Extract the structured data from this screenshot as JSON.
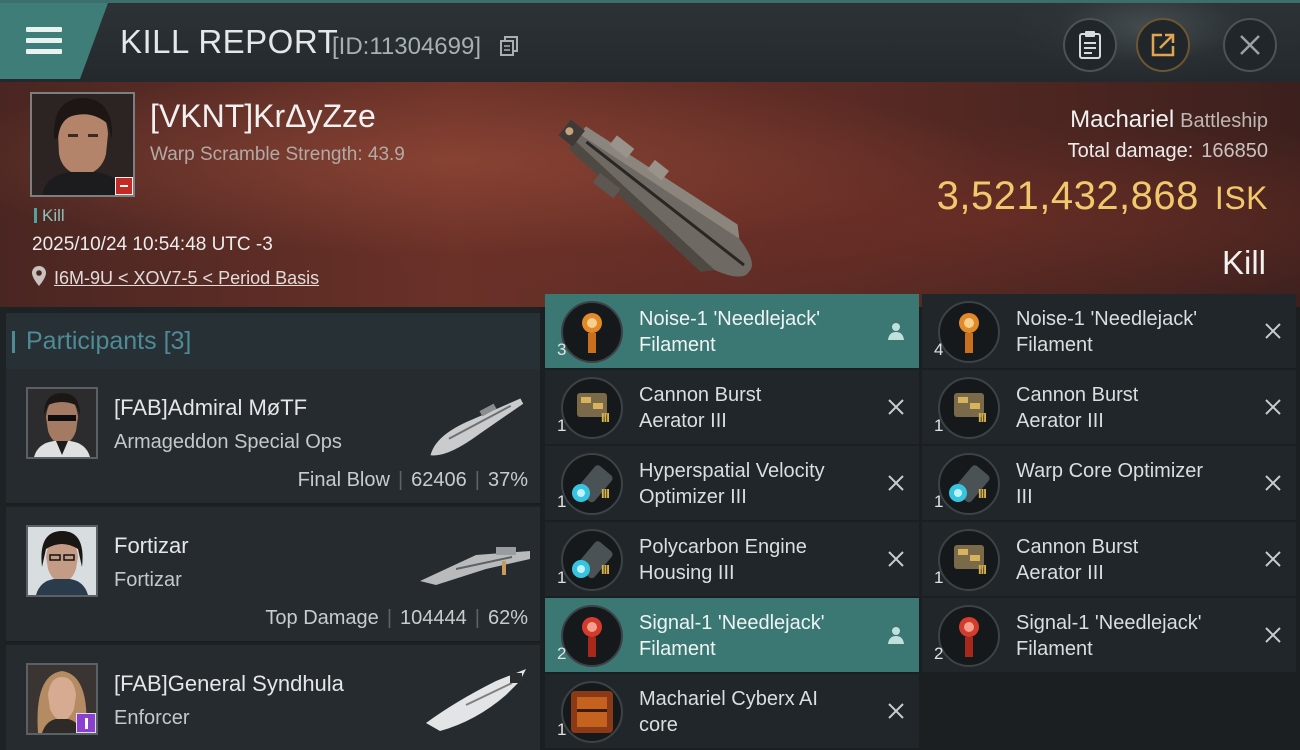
{
  "header": {
    "title": "KILL REPORT",
    "report_id": "[ID:11304699]",
    "menu_icon": "hamburger-icon",
    "copy_icon": "copy-icon",
    "buttons": [
      "clipboard-icon",
      "share-icon",
      "close-icon"
    ]
  },
  "victim": {
    "name": "[VKNT]KrΔyZze",
    "scramble": "Warp Scramble Strength: 43.9",
    "kill_tag": "Kill",
    "datetime": "2025/10/24 10:54:48 UTC -3",
    "location": "I6M-9U < XOV7-5 < Period Basis",
    "ship_name": "Machariel",
    "ship_class": "Battleship",
    "total_damage_label": "Total damage:",
    "total_damage": "166850",
    "isk_value": "3,521,432,868",
    "isk_unit": "ISK",
    "result": "Kill"
  },
  "participants": {
    "header_label": "Participants",
    "header_count": "[3]",
    "list": [
      {
        "name": "[FAB]Admiral MøTF",
        "ship": "Armageddon Special Ops",
        "stat_label": "Final Blow",
        "damage": "62406",
        "percent": "37%"
      },
      {
        "name": "Fortizar",
        "ship": "Fortizar",
        "stat_label": "Top Damage",
        "damage": "104444",
        "percent": "62%"
      },
      {
        "name": "[FAB]General Syndhula",
        "ship": "Enforcer",
        "stat_label": "",
        "damage": "",
        "percent": ""
      }
    ]
  },
  "items_left": [
    {
      "name1": "Noise-1 'Needlejack'",
      "name2": "Filament",
      "qty": "3",
      "icon": "filament-orange-icon",
      "action": "person-icon",
      "highlight": true
    },
    {
      "name1": "Cannon Burst",
      "name2": "Aerator III",
      "qty": "1",
      "icon": "module-gold-icon",
      "action": "close-icon",
      "highlight": false
    },
    {
      "name1": "Hyperspatial Velocity",
      "name2": "Optimizer III",
      "qty": "1",
      "icon": "rig-cyan-icon",
      "action": "close-icon",
      "highlight": false
    },
    {
      "name1": "Polycarbon Engine",
      "name2": "Housing III",
      "qty": "1",
      "icon": "rig-cyan-icon",
      "action": "close-icon",
      "highlight": false
    },
    {
      "name1": "Signal-1 'Needlejack'",
      "name2": "Filament",
      "qty": "2",
      "icon": "filament-red-icon",
      "action": "person-icon",
      "highlight": true
    },
    {
      "name1": "Machariel Cyberx AI",
      "name2": "core",
      "qty": "1",
      "icon": "ai-core-icon",
      "action": "close-icon",
      "highlight": false
    }
  ],
  "items_right": [
    {
      "name1": "Noise-1 'Needlejack'",
      "name2": "Filament",
      "qty": "4",
      "icon": "filament-orange-icon",
      "action": "close-icon",
      "highlight": false
    },
    {
      "name1": "Cannon Burst",
      "name2": "Aerator III",
      "qty": "1",
      "icon": "module-gold-icon",
      "action": "close-icon",
      "highlight": false
    },
    {
      "name1": "Warp Core Optimizer",
      "name2": "III",
      "qty": "1",
      "icon": "rig-cyan-icon",
      "action": "close-icon",
      "highlight": false
    },
    {
      "name1": "Cannon Burst",
      "name2": "Aerator III",
      "qty": "1",
      "icon": "module-gold-icon",
      "action": "close-icon",
      "highlight": false
    },
    {
      "name1": "Signal-1 'Needlejack'",
      "name2": "Filament",
      "qty": "2",
      "icon": "filament-red-icon",
      "action": "close-icon",
      "highlight": false
    }
  ],
  "colors": {
    "accent_teal": "#3b7874",
    "isk_gold": "#f2c86d",
    "tech_level": "#d6b24a"
  }
}
